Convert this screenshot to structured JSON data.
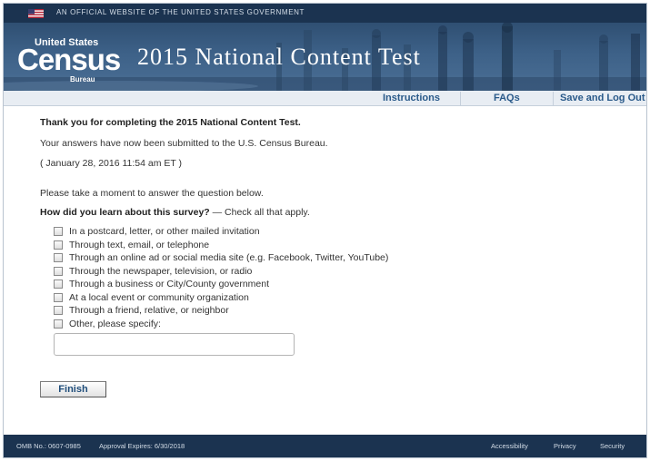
{
  "gov_banner": {
    "text": "AN OFFICIAL WEBSITE OF THE UNITED STATES GOVERNMENT",
    "flag_icon": "us-flag-icon"
  },
  "header": {
    "logo_top": "United States",
    "logo_main": "Census",
    "logo_bottom": "Bureau",
    "title": "2015 National Content Test",
    "background_color": "#3d6188"
  },
  "nav": {
    "instructions": "Instructions",
    "faqs": "FAQs",
    "save_logout": "Save and Log Out",
    "link_color": "#2a5a8a"
  },
  "main": {
    "thanks": "Thank you for completing the 2015 National Content Test.",
    "submitted": "Your answers have now been submitted to the U.S. Census Bureau.",
    "timestamp": "( January 28, 2016 11:54 am ET )",
    "prompt": "Please take a moment to answer the question below.",
    "question_bold": "How did you learn about this survey?",
    "question_hint": " — Check all that apply.",
    "options": [
      {
        "label": "In a postcard, letter, or other mailed invitation",
        "checked": false
      },
      {
        "label": "Through text, email, or telephone",
        "checked": false
      },
      {
        "label": "Through an online ad or social media site (e.g. Facebook, Twitter, YouTube)",
        "checked": false
      },
      {
        "label": "Through the newspaper, television, or radio",
        "checked": false
      },
      {
        "label": "Through a business or City/County government",
        "checked": false
      },
      {
        "label": "At a local event or community organization",
        "checked": false
      },
      {
        "label": "Through a friend, relative, or neighbor",
        "checked": false
      },
      {
        "label": "Other, please specify:",
        "checked": false
      }
    ],
    "specify_value": "",
    "finish_label": "Finish"
  },
  "footer": {
    "omb": "OMB No.: 0607-0985",
    "approval": "Approval Expires: 6/30/2018",
    "accessibility": "Accessibility",
    "privacy": "Privacy",
    "security": "Security",
    "background_color": "#1b3350"
  }
}
